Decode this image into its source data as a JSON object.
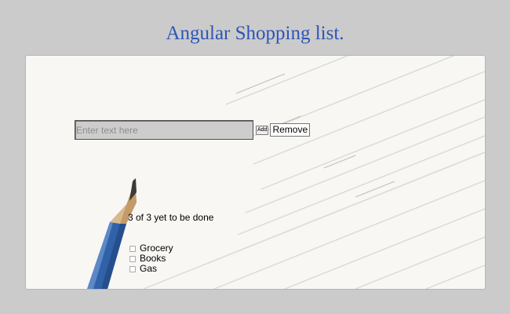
{
  "header": {
    "title": "Angular Shopping list."
  },
  "entry": {
    "placeholder": "Enter text here",
    "value": "",
    "add_label": "Add",
    "remove_label": "Remove"
  },
  "status": {
    "remaining_text": "3 of 3 yet to be done"
  },
  "todos": [
    {
      "label": "Grocery",
      "checked": false
    },
    {
      "label": "Books",
      "checked": false
    },
    {
      "label": "Gas",
      "checked": false
    }
  ],
  "colors": {
    "title": "#2d55b8",
    "page_background": "#cbcbcb",
    "card_background": "#f8f7f4",
    "pencil_body": "#2f62a8",
    "input_background": "#cdcdcd"
  },
  "icons": {
    "pencil": "pencil-illustration"
  }
}
